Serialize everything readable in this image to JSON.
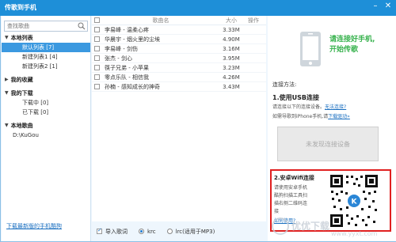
{
  "window": {
    "title": "传歌到手机",
    "controls": {
      "minimize": "–",
      "close": "✕"
    }
  },
  "sidebar": {
    "search_placeholder": "查找歌曲",
    "groups": [
      {
        "label": "本地列表",
        "items": [
          "默认列表 [7]",
          "新建列表1 [4]",
          "新建列表2 [1]"
        ],
        "selected_index": 0
      },
      {
        "label": "我的收藏",
        "items": []
      },
      {
        "label": "我的下载",
        "items": [
          "下载中 [0]",
          "已下载 [0]"
        ]
      },
      {
        "label": "本地歌曲",
        "items": [
          "D:\\KuGou"
        ]
      }
    ],
    "footer_link": "下载最新版的手机酷狗"
  },
  "song_list": {
    "headers": {
      "name": "歌曲名",
      "size": "大小",
      "op": "操作"
    },
    "rows": [
      {
        "name": "李易峰 - 温柔心疼",
        "size": "3.33M"
      },
      {
        "name": "华晨宇 - 烟火里的尘埃",
        "size": "4.90M"
      },
      {
        "name": "李易峰 - 剑伤",
        "size": "3.16M"
      },
      {
        "name": "张杰 - 剑心",
        "size": "3.95M"
      },
      {
        "name": "筷子兄弟 - 小苹果",
        "size": "3.23M"
      },
      {
        "name": "零点乐队 - 相信我",
        "size": "4.26M"
      },
      {
        "name": "孙楠 - 感知成长的神奇",
        "size": "3.43M"
      }
    ],
    "bottom": {
      "import_lyrics": "导入歌词",
      "opt_krc": "krc",
      "opt_lrc": "lrc(适用于MP3)"
    }
  },
  "right_panel": {
    "connect_text_line1": "请连接好手机,",
    "connect_text_line2": "开始传歌",
    "method_title": "连接方法:",
    "usb_title": "1.使用USB连接",
    "usb_line1_prefix": "请连接以下的连接设备。",
    "usb_line1_link": "无法连接?",
    "usb_line2_prefix": "如需导歌到iPhone手机,请",
    "usb_line2_link": "下载驱动»",
    "no_device_button": "未发现连接设备",
    "wifi_title": "2.安卓Wifi连接",
    "wifi_desc": [
      "请使用安卓手机",
      "酷狗扫描工具扫",
      "描右侧二维码连",
      "接"
    ],
    "wifi_how": "如何使用?"
  },
  "watermark": {
    "text": "优优下载",
    "domain": "www.yyxt.com"
  },
  "colors": {
    "titlebar": "#1e8fd8",
    "selected": "#3b99e0",
    "link": "#1a6fc0",
    "green": "#37b24d",
    "highlight_border": "#e02020"
  }
}
